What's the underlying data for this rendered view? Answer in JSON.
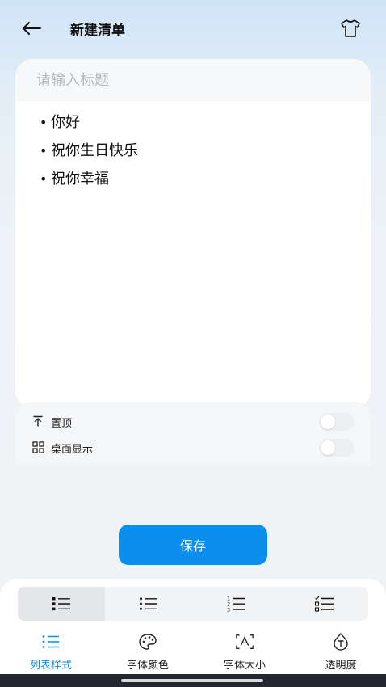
{
  "header": {
    "title": "新建清单",
    "back_icon": "arrow-left-icon",
    "theme_icon": "tshirt-icon"
  },
  "editor": {
    "title_placeholder": "请输入标题",
    "title_value": "",
    "items": [
      "你好",
      "祝你生日快乐",
      "祝你幸福"
    ]
  },
  "options": {
    "pin": {
      "label": "置顶",
      "icon": "pin-to-top-icon",
      "enabled": false
    },
    "desktop": {
      "label": "桌面显示",
      "icon": "grid-icon",
      "enabled": false
    }
  },
  "actions": {
    "save_label": "保存"
  },
  "list_styles": {
    "selected": 0,
    "options": [
      "bold-bullet-list-icon",
      "bullet-list-icon",
      "numbered-list-icon",
      "checklist-icon"
    ]
  },
  "tabs": [
    {
      "label": "列表样式",
      "icon": "list-style-icon",
      "active": true
    },
    {
      "label": "字体颜色",
      "icon": "palette-icon",
      "active": false
    },
    {
      "label": "字体大小",
      "icon": "font-size-icon",
      "active": false
    },
    {
      "label": "透明度",
      "icon": "transparency-icon",
      "active": false
    }
  ],
  "colors": {
    "accent": "#0a8fee",
    "header_gradient_top": "#cfe4f7",
    "background": "#f1f3f5",
    "card": "#ffffff",
    "placeholder": "#b3b7bc",
    "nav_bar": "#23262c"
  }
}
